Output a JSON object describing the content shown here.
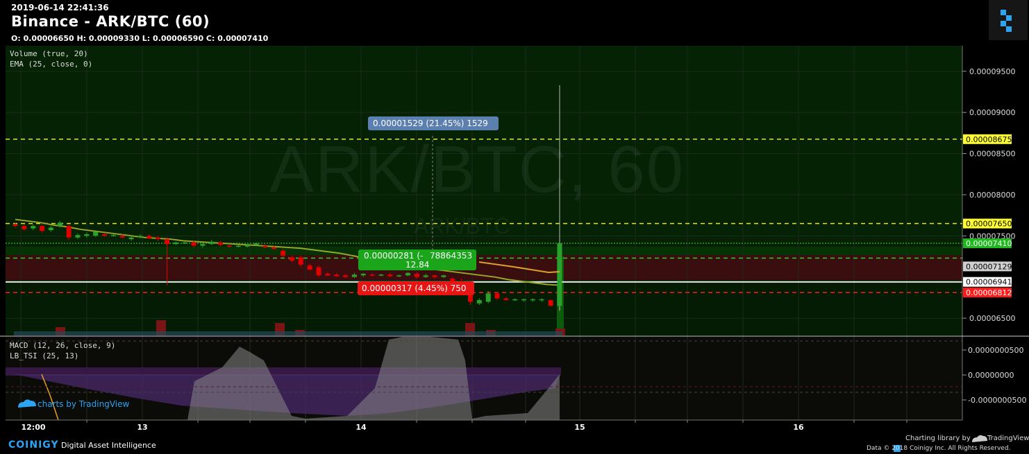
{
  "header": {
    "timestamp": "2019-06-14 22:41:36",
    "title": "Binance - ARK/BTC (60)",
    "ohlc": "O: 0.00006650 H: 0.00009330 L: 0.00006590 C: 0.00007410"
  },
  "watermark": {
    "main": "ARK/BTC, 60",
    "sub": "ARK/BTC"
  },
  "indicators": {
    "volume": "Volume (true, 20)",
    "ema": "EMA (25, close, 0)",
    "macd": "MACD (12, 26, close, 9)",
    "lbtsi": "LB_TSI (25, 13)"
  },
  "annotations": {
    "measure_up": "0.00001529 (21.45%) 1529",
    "measure_mid_1": "0.00000281 (-",
    "measure_mid_2": "78864353",
    "measure_mid_3": "12.84",
    "measure_down": "0.00000317 (4.45%) 750"
  },
  "footer": {
    "brand": "COINIGY",
    "tagline": "Digital Asset Intelligence",
    "library": "Charting library by",
    "tv": "TradingView",
    "copyright": "Data © 2018 Coinigy Inc. All Rights Reserved.",
    "tv_watermark": "charts by TradingView"
  },
  "colors": {
    "up": "#2ca02c",
    "down": "#e00000",
    "ema": "#9aa52a",
    "band_green": "#063a06",
    "band_red": "#3a0e0e",
    "yellow": "#e8e82a"
  },
  "chart_data": {
    "type": "candlestick",
    "title": "Binance - ARK/BTC (60)",
    "x_tick_labels": [
      "12:00",
      "13",
      "14",
      "15",
      "16"
    ],
    "y_tick_labels": [
      "0.00009500",
      "0.00009000",
      "0.00008500",
      "0.00008000",
      "0.00007500",
      "0.00006500"
    ],
    "ylim": [
      6.29e-05,
      9.81e-05
    ],
    "price_labels": [
      {
        "value": 8.675e-05,
        "label": "0.00008675",
        "style": "yellow"
      },
      {
        "value": 7.65e-05,
        "label": "0.00007650",
        "style": "yellow"
      },
      {
        "value": 7.41e-05,
        "label": "0.00007410",
        "style": "green"
      },
      {
        "value": 7.129e-05,
        "label": "0.00007129",
        "style": "gray"
      },
      {
        "value": 6.941e-05,
        "label": "0.00006941",
        "style": "white"
      },
      {
        "value": 6.812e-05,
        "label": "0.00006812",
        "style": "red"
      }
    ],
    "macd_ticks": [
      "0.0000000500",
      "0.00000000",
      "-0.0000000500"
    ],
    "candles": [
      {
        "o": 7.64,
        "c": 7.62,
        "h": 7.66,
        "l": 7.6
      },
      {
        "o": 7.62,
        "c": 7.58,
        "h": 7.64,
        "l": 7.56
      },
      {
        "o": 7.59,
        "c": 7.62,
        "h": 7.64,
        "l": 7.57
      },
      {
        "o": 7.62,
        "c": 7.56,
        "h": 7.64,
        "l": 7.54
      },
      {
        "o": 7.57,
        "c": 7.6,
        "h": 7.62,
        "l": 7.55
      },
      {
        "o": 7.62,
        "c": 7.66,
        "h": 7.68,
        "l": 7.6
      },
      {
        "o": 7.62,
        "c": 7.48,
        "h": 7.64,
        "l": 7.45
      },
      {
        "o": 7.48,
        "c": 7.51,
        "h": 7.53,
        "l": 7.46
      },
      {
        "o": 7.5,
        "c": 7.52,
        "h": 7.54,
        "l": 7.48
      },
      {
        "o": 7.5,
        "c": 7.55,
        "h": 7.57,
        "l": 7.49
      },
      {
        "o": 7.52,
        "c": 7.5,
        "h": 7.54,
        "l": 7.49
      },
      {
        "o": 7.5,
        "c": 7.51,
        "h": 7.52,
        "l": 7.49
      },
      {
        "o": 7.5,
        "c": 7.48,
        "h": 7.52,
        "l": 7.47
      },
      {
        "o": 7.46,
        "c": 7.48,
        "h": 7.5,
        "l": 7.44
      },
      {
        "o": 7.48,
        "c": 7.5,
        "h": 7.52,
        "l": 7.47
      },
      {
        "o": 7.5,
        "c": 7.47,
        "h": 7.52,
        "l": 7.46
      },
      {
        "o": 7.48,
        "c": 7.46,
        "h": 7.5,
        "l": 7.44
      },
      {
        "o": 7.46,
        "c": 7.4,
        "h": 7.48,
        "l": 6.9
      },
      {
        "o": 7.4,
        "c": 7.42,
        "h": 7.43,
        "l": 7.39
      },
      {
        "o": 7.41,
        "c": 7.42,
        "h": 7.43,
        "l": 7.4
      },
      {
        "o": 7.42,
        "c": 7.38,
        "h": 7.44,
        "l": 7.36
      },
      {
        "o": 7.38,
        "c": 7.4,
        "h": 7.42,
        "l": 7.36
      },
      {
        "o": 7.4,
        "c": 7.43,
        "h": 7.45,
        "l": 7.39
      },
      {
        "o": 7.42,
        "c": 7.39,
        "h": 7.44,
        "l": 7.37
      },
      {
        "o": 7.38,
        "c": 7.37,
        "h": 7.4,
        "l": 7.36
      },
      {
        "o": 7.37,
        "c": 7.38,
        "h": 7.39,
        "l": 7.36
      },
      {
        "o": 7.37,
        "c": 7.39,
        "h": 7.4,
        "l": 7.36
      },
      {
        "o": 7.39,
        "c": 7.41,
        "h": 7.42,
        "l": 7.38
      },
      {
        "o": 7.38,
        "c": 7.36,
        "h": 7.4,
        "l": 7.35
      },
      {
        "o": 7.36,
        "c": 7.34,
        "h": 7.38,
        "l": 7.33
      },
      {
        "o": 7.32,
        "c": 7.26,
        "h": 7.34,
        "l": 7.24
      },
      {
        "o": 7.24,
        "c": 7.2,
        "h": 7.26,
        "l": 7.18
      },
      {
        "o": 7.24,
        "c": 7.15,
        "h": 7.26,
        "l": 7.12
      },
      {
        "o": 7.14,
        "c": 7.09,
        "h": 7.16,
        "l": 7.08
      },
      {
        "o": 7.12,
        "c": 7.02,
        "h": 7.14,
        "l": 7.0
      },
      {
        "o": 7.04,
        "c": 7.02,
        "h": 7.06,
        "l": 7.01
      },
      {
        "o": 7.03,
        "c": 7.01,
        "h": 7.05,
        "l": 7.0
      },
      {
        "o": 7.02,
        "c": 7.0,
        "h": 7.04,
        "l": 6.99
      },
      {
        "o": 7.0,
        "c": 7.03,
        "h": 7.05,
        "l": 6.99
      },
      {
        "o": 7.02,
        "c": 7.04,
        "h": 7.05,
        "l": 7.0
      },
      {
        "o": 7.03,
        "c": 7.02,
        "h": 7.05,
        "l": 7.01
      },
      {
        "o": 7.02,
        "c": 7.03,
        "h": 7.04,
        "l": 7.01
      },
      {
        "o": 7.03,
        "c": 7.01,
        "h": 7.05,
        "l": 7.0
      },
      {
        "o": 7.01,
        "c": 7.02,
        "h": 7.03,
        "l": 7.0
      },
      {
        "o": 7.02,
        "c": 7.05,
        "h": 7.06,
        "l": 7.01
      },
      {
        "o": 7.04,
        "c": 7.0,
        "h": 7.06,
        "l": 6.98
      },
      {
        "o": 7.0,
        "c": 7.02,
        "h": 7.04,
        "l": 6.99
      },
      {
        "o": 7.02,
        "c": 7.0,
        "h": 7.03,
        "l": 6.98
      },
      {
        "o": 7.0,
        "c": 7.02,
        "h": 7.03,
        "l": 6.99
      },
      {
        "o": 6.98,
        "c": 6.88,
        "h": 7.0,
        "l": 6.86
      },
      {
        "o": 6.95,
        "c": 6.88,
        "h": 6.98,
        "l": 6.86
      },
      {
        "o": 6.88,
        "c": 6.7,
        "h": 6.9,
        "l": 6.66
      },
      {
        "o": 6.68,
        "c": 6.72,
        "h": 6.74,
        "l": 6.66
      },
      {
        "o": 6.7,
        "c": 6.8,
        "h": 6.83,
        "l": 6.68
      },
      {
        "o": 6.8,
        "c": 6.74,
        "h": 6.82,
        "l": 6.72
      },
      {
        "o": 6.74,
        "c": 6.72,
        "h": 6.76,
        "l": 6.71
      },
      {
        "o": 6.72,
        "c": 6.73,
        "h": 6.74,
        "l": 6.71
      },
      {
        "o": 6.72,
        "c": 6.73,
        "h": 6.74,
        "l": 6.7
      },
      {
        "o": 6.72,
        "c": 6.73,
        "h": 6.74,
        "l": 6.7
      },
      {
        "o": 6.72,
        "c": 6.73,
        "h": 6.74,
        "l": 6.7
      },
      {
        "o": 6.72,
        "c": 6.65,
        "h": 6.73,
        "l": 6.64
      },
      {
        "o": 6.65,
        "c": 7.41,
        "h": 9.33,
        "l": 6.59
      }
    ],
    "ema": [
      7.7,
      7.68,
      7.66,
      7.63,
      7.61,
      7.58,
      7.56,
      7.54,
      7.52,
      7.5,
      7.48,
      7.47,
      7.46,
      7.44,
      7.43,
      7.42,
      7.41,
      7.4,
      7.39,
      7.38,
      7.37,
      7.36,
      7.35,
      7.33,
      7.31,
      7.29,
      7.26,
      7.23,
      7.2,
      7.17,
      7.14,
      7.12,
      7.1,
      7.08,
      7.06,
      7.04,
      7.02,
      7.0,
      6.97,
      6.95,
      6.93,
      6.91,
      6.9
    ]
  }
}
